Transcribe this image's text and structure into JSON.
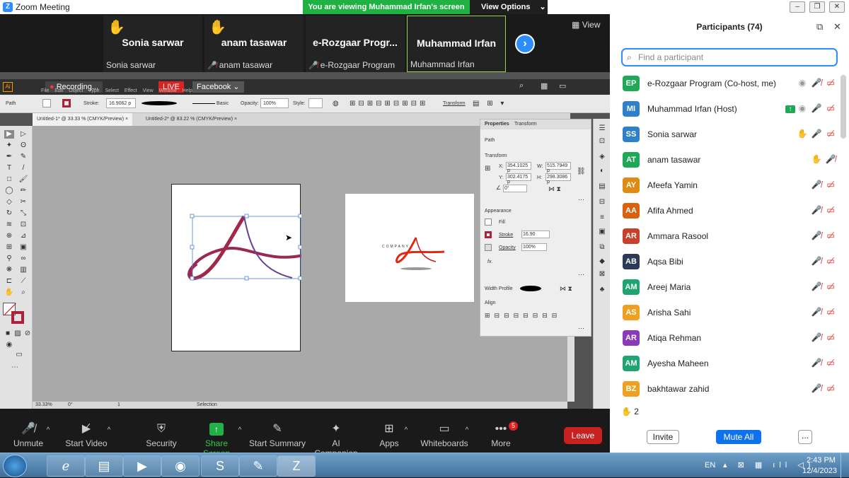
{
  "window": {
    "title": "Zoom Meeting",
    "viewing_banner": "You are viewing Muhammad Irfan's screen",
    "view_options": "View Options"
  },
  "video_strip": {
    "tiles": [
      {
        "name": "Sonia sarwar",
        "label": "Sonia sarwar",
        "hand": true,
        "muted": false
      },
      {
        "name": "anam tasawar",
        "label": "anam tasawar",
        "hand": true,
        "muted": true
      },
      {
        "name": "e-Rozgaar  Progr...",
        "label": "e-Rozgaar Program",
        "hand": false,
        "muted": true
      },
      {
        "name": "Muhammad Irfan",
        "label": "Muhammad Irfan",
        "hand": false,
        "muted": false
      }
    ],
    "view_label": "View"
  },
  "illustrator": {
    "recording": "Recording...",
    "live": "LIVE",
    "facebook": "Facebook",
    "menus": [
      "File",
      "Edit",
      "Object",
      "Type",
      "Select",
      "Effect",
      "View",
      "Window",
      "Help"
    ],
    "control": {
      "path": "Path",
      "stroke_label": "Stroke:",
      "stroke_value": "16.9062 p",
      "profile": "Basic",
      "opacity_label": "Opacity:",
      "opacity_value": "100%",
      "style_label": "Style:",
      "transform": "Transform"
    },
    "tabs": [
      "Untitled-1* @ 33.33 % (CMYK/Preview)",
      "Untitled-2* @ 83.22 % (CMYK/Preview)"
    ],
    "properties": {
      "tab_props": "Properties",
      "tab_transform": "Transform",
      "path": "Path",
      "transform": "Transform",
      "x_label": "X:",
      "x": "354.1025 p",
      "y_label": "Y:",
      "y": "302.4175 p",
      "w_label": "W:",
      "w": "515.7949 p",
      "h_label": "H:",
      "h": "298.3086 p",
      "angle": "0°",
      "appearance": "Appearance",
      "fill": "Fill",
      "stroke": "Stroke",
      "stroke_value": "16.90",
      "opacity": "Opacity",
      "opacity_value": "100%",
      "fx": "fx.",
      "width_profile": "Width Profile",
      "align": "Align"
    },
    "status": {
      "zoom": "33.33%",
      "angle": "0°",
      "page": "1",
      "tool": "Selection"
    },
    "logo_text": "COMPANY"
  },
  "toolbar": {
    "unmute": "Unmute",
    "start_video": "Start Video",
    "security": "Security",
    "share_screen": "Share Screen",
    "start_summary": "Start Summary",
    "ai_companion": "AI Companion",
    "apps": "Apps",
    "whiteboards": "Whiteboards",
    "more": "More",
    "more_badge": "5",
    "leave": "Leave"
  },
  "participants": {
    "header": "Participants (74)",
    "search_placeholder": "Find a participant",
    "list": [
      {
        "initials": "EP",
        "name": "e-Rozgaar Program (Co-host, me)",
        "color": "#1fa855"
      },
      {
        "initials": "MI",
        "name": "Muhammad Irfan (Host)",
        "color": "#2f80c9"
      },
      {
        "initials": "SS",
        "name": "Sonia sarwar",
        "color": "#2f80c9"
      },
      {
        "initials": "AT",
        "name": "anam tasawar",
        "color": "#1fa855"
      },
      {
        "initials": "AY",
        "name": "Afeefa Yamin",
        "color": "#e08a16"
      },
      {
        "initials": "AA",
        "name": "Afifa Ahmed",
        "color": "#d8600e"
      },
      {
        "initials": "AR",
        "name": "Ammara Rasool",
        "color": "#c8402a"
      },
      {
        "initials": "AB",
        "name": "Aqsa Bibi",
        "color": "#2b3a56"
      },
      {
        "initials": "AM",
        "name": "Areej Maria",
        "color": "#20a472"
      },
      {
        "initials": "AS",
        "name": "Arisha Sahi",
        "color": "#f0a020"
      },
      {
        "initials": "AR",
        "name": "Atiqa Rehman",
        "color": "#8a3ab8"
      },
      {
        "initials": "AM",
        "name": "Ayesha Maheen",
        "color": "#20a472"
      },
      {
        "initials": "BZ",
        "name": "bakhtawar zahid",
        "color": "#f0a020"
      }
    ],
    "raised_count": "2",
    "invite": "Invite",
    "mute_all": "Mute All",
    "more": "..."
  },
  "taskbar": {
    "lang": "EN",
    "time": "2:43 PM",
    "date": "12/4/2023"
  }
}
